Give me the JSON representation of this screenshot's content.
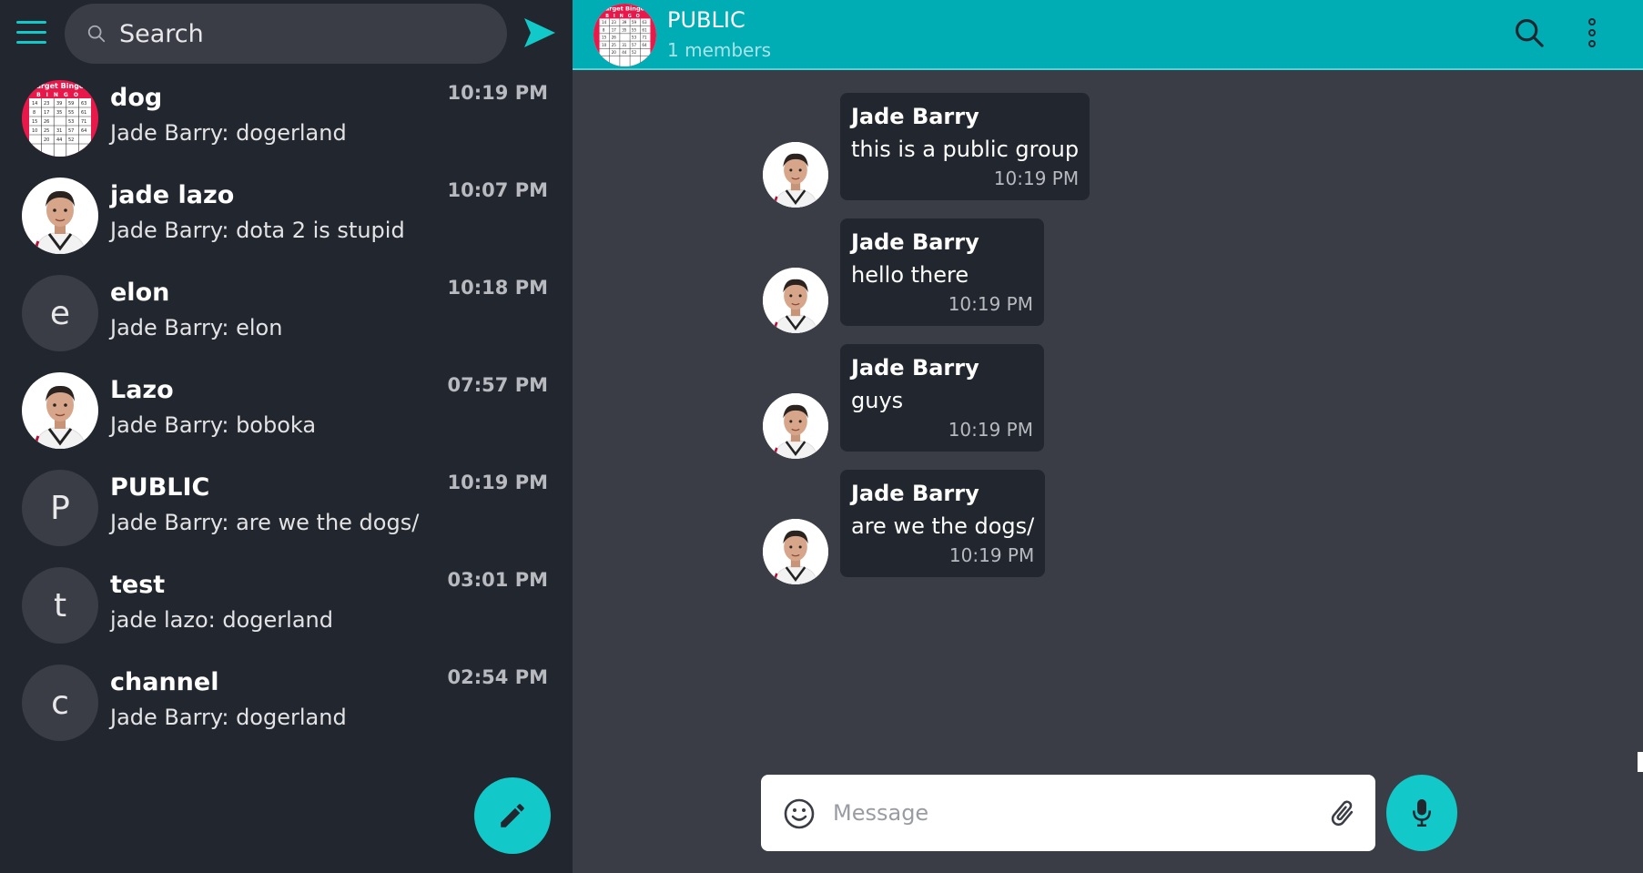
{
  "search": {
    "placeholder": "Search"
  },
  "chats": [
    {
      "name": "dog",
      "preview": "Jade Barry: dogerland",
      "time": "10:19 PM",
      "avatar": "bingo-card-image"
    },
    {
      "name": "jade lazo",
      "preview": "Jade Barry: dota 2 is stupid",
      "time": "10:07 PM",
      "avatar": "boy-photo"
    },
    {
      "name": "elon",
      "preview": "Jade Barry: elon",
      "time": "10:18 PM",
      "avatar_letter": "e"
    },
    {
      "name": "Lazo",
      "preview": "Jade Barry: boboka",
      "time": "07:57 PM",
      "avatar": "boy-photo"
    },
    {
      "name": "PUBLIC",
      "preview": "Jade Barry: are we the dogs/",
      "time": "10:19 PM",
      "avatar_letter": "P"
    },
    {
      "name": "test",
      "preview": "jade lazo: dogerland",
      "time": "03:01 PM",
      "avatar_letter": "t"
    },
    {
      "name": "channel",
      "preview": "Jade Barry: dogerland",
      "time": "02:54 PM",
      "avatar_letter": "c"
    }
  ],
  "header": {
    "title": "PUBLIC",
    "subtitle": "1 members"
  },
  "messages": [
    {
      "author": "Jade Barry",
      "text": "this is a public group",
      "time": "10:19 PM"
    },
    {
      "author": "Jade Barry",
      "text": "hello there",
      "time": "10:19 PM"
    },
    {
      "author": "Jade Barry",
      "text": "guys",
      "time": "10:19 PM"
    },
    {
      "author": "Jade Barry",
      "text": "are we the dogs/",
      "time": "10:19 PM"
    }
  ],
  "composer": {
    "placeholder": "Message"
  },
  "colors": {
    "accent": "#13c8c8",
    "header": "#00adb5",
    "sidebar": "#22262f",
    "main_bg": "#3a3d45"
  }
}
